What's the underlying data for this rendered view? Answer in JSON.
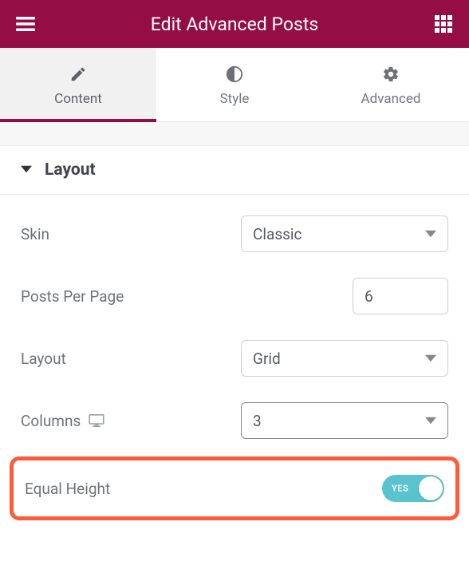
{
  "header": {
    "title": "Edit Advanced Posts"
  },
  "tabs": {
    "content": "Content",
    "style": "Style",
    "advanced": "Advanced"
  },
  "section": {
    "title": "Layout"
  },
  "controls": {
    "skin": {
      "label": "Skin",
      "value": "Classic"
    },
    "postsPerPage": {
      "label": "Posts Per Page",
      "value": "6"
    },
    "layout": {
      "label": "Layout",
      "value": "Grid"
    },
    "columns": {
      "label": "Columns",
      "value": "3"
    },
    "equalHeight": {
      "label": "Equal Height",
      "value": "YES"
    }
  }
}
